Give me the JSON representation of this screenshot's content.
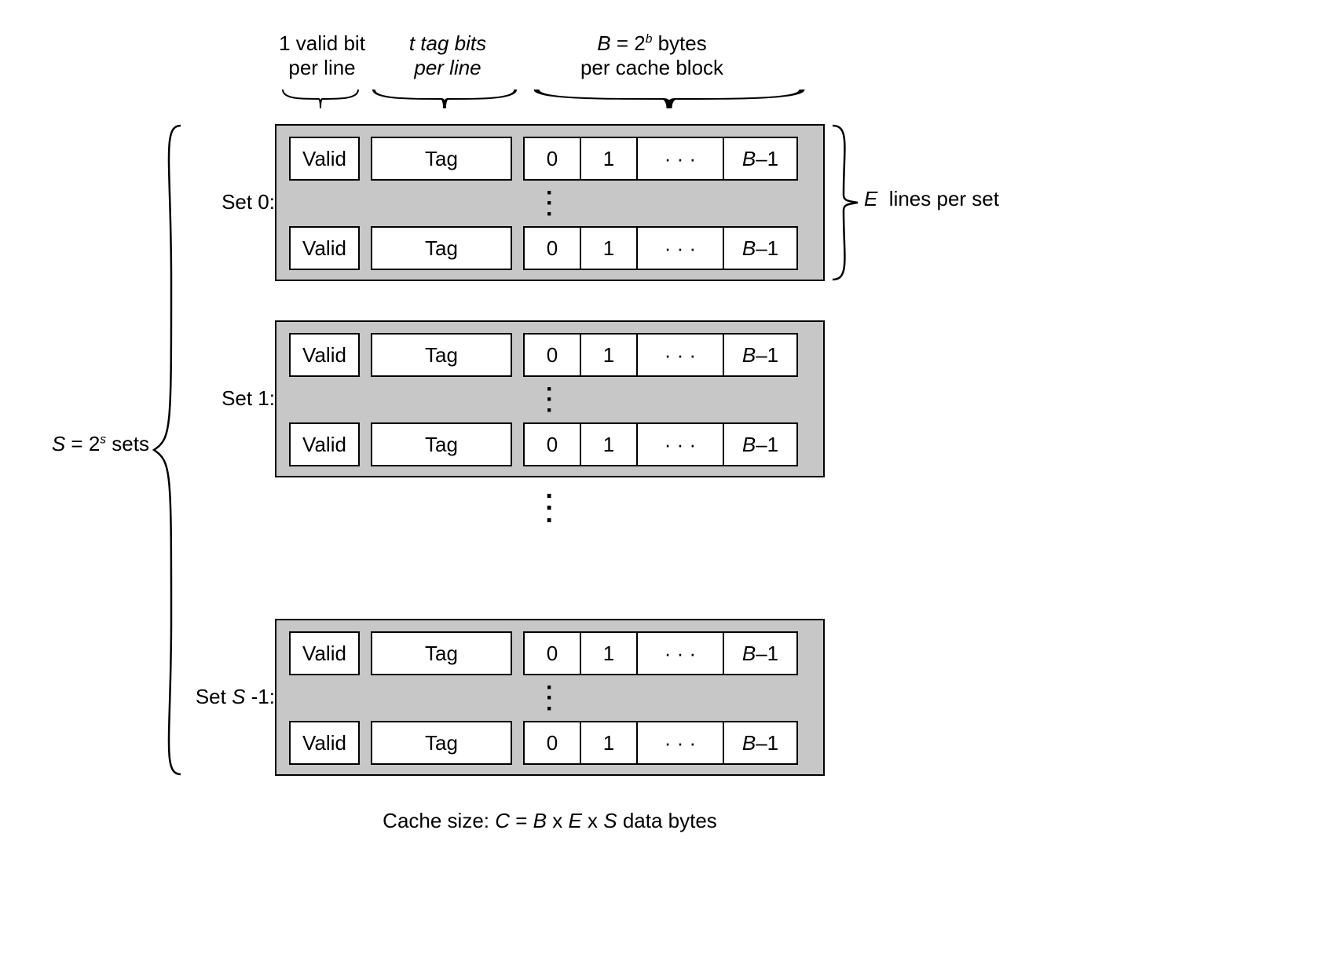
{
  "annotations": {
    "valid_bit": "1 valid bit\nper line",
    "tag_bits": "t tag bits\nper line",
    "block_bytes": "B = 2ᵇ bytes\nper cache block",
    "e_lines": "E  lines per set",
    "s_sets": "S = 2ˢ sets"
  },
  "set_labels": {
    "set0": "Set 0:",
    "set1": "Set 1:",
    "setN_prefix": "Set ",
    "setN_var": "S",
    "setN_suffix": " -1:"
  },
  "line": {
    "valid": "Valid",
    "tag": "Tag",
    "byte0": "0",
    "byte1": "1",
    "dots": "· · ·",
    "last_prefix": "B",
    "last_suffix": "–1"
  },
  "vdots": "⋮",
  "caption": {
    "prefix": "Cache size:  ",
    "formula": "C = B x E x S",
    "suffix": " data bytes"
  }
}
